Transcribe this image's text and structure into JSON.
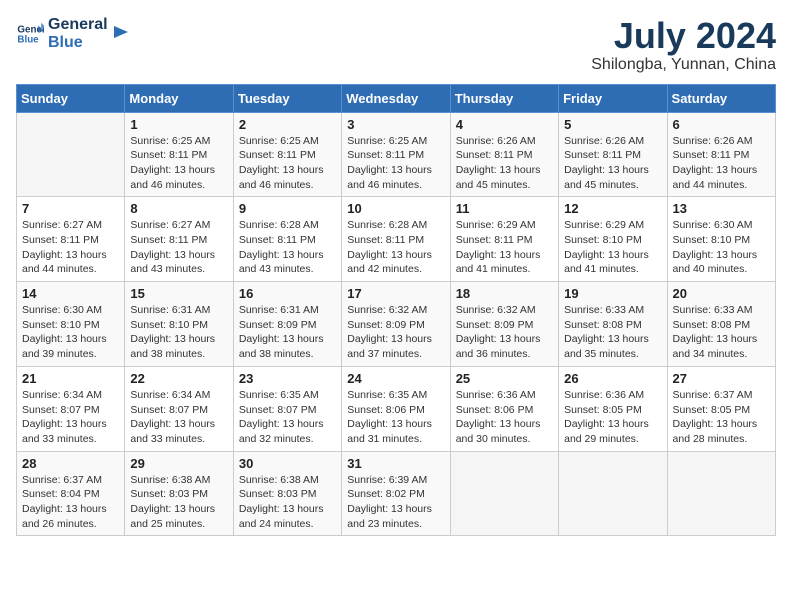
{
  "header": {
    "logo_line1": "General",
    "logo_line2": "Blue",
    "title": "July 2024",
    "subtitle": "Shilongba, Yunnan, China"
  },
  "weekdays": [
    "Sunday",
    "Monday",
    "Tuesday",
    "Wednesday",
    "Thursday",
    "Friday",
    "Saturday"
  ],
  "weeks": [
    [
      {
        "day": "",
        "sunrise": "",
        "sunset": "",
        "daylight": ""
      },
      {
        "day": "1",
        "sunrise": "6:25 AM",
        "sunset": "8:11 PM",
        "daylight": "13 hours and 46 minutes."
      },
      {
        "day": "2",
        "sunrise": "6:25 AM",
        "sunset": "8:11 PM",
        "daylight": "13 hours and 46 minutes."
      },
      {
        "day": "3",
        "sunrise": "6:25 AM",
        "sunset": "8:11 PM",
        "daylight": "13 hours and 46 minutes."
      },
      {
        "day": "4",
        "sunrise": "6:26 AM",
        "sunset": "8:11 PM",
        "daylight": "13 hours and 45 minutes."
      },
      {
        "day": "5",
        "sunrise": "6:26 AM",
        "sunset": "8:11 PM",
        "daylight": "13 hours and 45 minutes."
      },
      {
        "day": "6",
        "sunrise": "6:26 AM",
        "sunset": "8:11 PM",
        "daylight": "13 hours and 44 minutes."
      }
    ],
    [
      {
        "day": "7",
        "sunrise": "6:27 AM",
        "sunset": "8:11 PM",
        "daylight": "13 hours and 44 minutes."
      },
      {
        "day": "8",
        "sunrise": "6:27 AM",
        "sunset": "8:11 PM",
        "daylight": "13 hours and 43 minutes."
      },
      {
        "day": "9",
        "sunrise": "6:28 AM",
        "sunset": "8:11 PM",
        "daylight": "13 hours and 43 minutes."
      },
      {
        "day": "10",
        "sunrise": "6:28 AM",
        "sunset": "8:11 PM",
        "daylight": "13 hours and 42 minutes."
      },
      {
        "day": "11",
        "sunrise": "6:29 AM",
        "sunset": "8:11 PM",
        "daylight": "13 hours and 41 minutes."
      },
      {
        "day": "12",
        "sunrise": "6:29 AM",
        "sunset": "8:10 PM",
        "daylight": "13 hours and 41 minutes."
      },
      {
        "day": "13",
        "sunrise": "6:30 AM",
        "sunset": "8:10 PM",
        "daylight": "13 hours and 40 minutes."
      }
    ],
    [
      {
        "day": "14",
        "sunrise": "6:30 AM",
        "sunset": "8:10 PM",
        "daylight": "13 hours and 39 minutes."
      },
      {
        "day": "15",
        "sunrise": "6:31 AM",
        "sunset": "8:10 PM",
        "daylight": "13 hours and 38 minutes."
      },
      {
        "day": "16",
        "sunrise": "6:31 AM",
        "sunset": "8:09 PM",
        "daylight": "13 hours and 38 minutes."
      },
      {
        "day": "17",
        "sunrise": "6:32 AM",
        "sunset": "8:09 PM",
        "daylight": "13 hours and 37 minutes."
      },
      {
        "day": "18",
        "sunrise": "6:32 AM",
        "sunset": "8:09 PM",
        "daylight": "13 hours and 36 minutes."
      },
      {
        "day": "19",
        "sunrise": "6:33 AM",
        "sunset": "8:08 PM",
        "daylight": "13 hours and 35 minutes."
      },
      {
        "day": "20",
        "sunrise": "6:33 AM",
        "sunset": "8:08 PM",
        "daylight": "13 hours and 34 minutes."
      }
    ],
    [
      {
        "day": "21",
        "sunrise": "6:34 AM",
        "sunset": "8:07 PM",
        "daylight": "13 hours and 33 minutes."
      },
      {
        "day": "22",
        "sunrise": "6:34 AM",
        "sunset": "8:07 PM",
        "daylight": "13 hours and 33 minutes."
      },
      {
        "day": "23",
        "sunrise": "6:35 AM",
        "sunset": "8:07 PM",
        "daylight": "13 hours and 32 minutes."
      },
      {
        "day": "24",
        "sunrise": "6:35 AM",
        "sunset": "8:06 PM",
        "daylight": "13 hours and 31 minutes."
      },
      {
        "day": "25",
        "sunrise": "6:36 AM",
        "sunset": "8:06 PM",
        "daylight": "13 hours and 30 minutes."
      },
      {
        "day": "26",
        "sunrise": "6:36 AM",
        "sunset": "8:05 PM",
        "daylight": "13 hours and 29 minutes."
      },
      {
        "day": "27",
        "sunrise": "6:37 AM",
        "sunset": "8:05 PM",
        "daylight": "13 hours and 28 minutes."
      }
    ],
    [
      {
        "day": "28",
        "sunrise": "6:37 AM",
        "sunset": "8:04 PM",
        "daylight": "13 hours and 26 minutes."
      },
      {
        "day": "29",
        "sunrise": "6:38 AM",
        "sunset": "8:03 PM",
        "daylight": "13 hours and 25 minutes."
      },
      {
        "day": "30",
        "sunrise": "6:38 AM",
        "sunset": "8:03 PM",
        "daylight": "13 hours and 24 minutes."
      },
      {
        "day": "31",
        "sunrise": "6:39 AM",
        "sunset": "8:02 PM",
        "daylight": "13 hours and 23 minutes."
      },
      {
        "day": "",
        "sunrise": "",
        "sunset": "",
        "daylight": ""
      },
      {
        "day": "",
        "sunrise": "",
        "sunset": "",
        "daylight": ""
      },
      {
        "day": "",
        "sunrise": "",
        "sunset": "",
        "daylight": ""
      }
    ]
  ],
  "labels": {
    "sunrise": "Sunrise:",
    "sunset": "Sunset:",
    "daylight": "Daylight:"
  }
}
